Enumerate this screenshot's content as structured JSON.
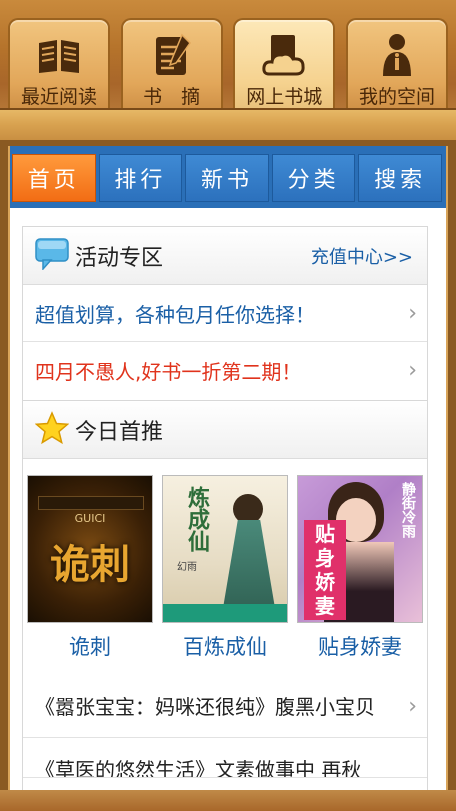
{
  "shelf_tabs": [
    {
      "label": "最近阅读",
      "icon": "open-book-icon"
    },
    {
      "label": "书　摘",
      "icon": "notepad-icon"
    },
    {
      "label": "网上书城",
      "icon": "cloud-book-icon",
      "active": true
    },
    {
      "label": "我的空间",
      "icon": "info-person-icon"
    }
  ],
  "nav": [
    "首页",
    "排行",
    "新书",
    "分类",
    "搜索"
  ],
  "activity": {
    "title": "活动专区",
    "link": "充值中心>>",
    "items": [
      "超值划算，各种包月任你选择！",
      "四月不愚人,好书一折第二期！"
    ]
  },
  "today": {
    "title": "今日首推",
    "books": [
      {
        "title": "诡刺",
        "cover_text": "诡刺",
        "cover_sub": "GUICI"
      },
      {
        "title": "百炼成仙",
        "cover_text": "炼成仙",
        "cover_sub": "幻雨"
      },
      {
        "title": "贴身娇妻",
        "cover_text": "贴身娇妻",
        "cover_sub": "静街冷雨"
      }
    ],
    "recs": [
      "《嚣张宝宝：妈咪还很纯》腹黑小宝贝",
      "《草医的悠然生活》文素做事中 再秋"
    ]
  },
  "colors": {
    "nav_blue": "#2a6fb7",
    "nav_active": "#f26d14",
    "link_blue": "#1a5fa6",
    "promo_red": "#e0331c"
  }
}
